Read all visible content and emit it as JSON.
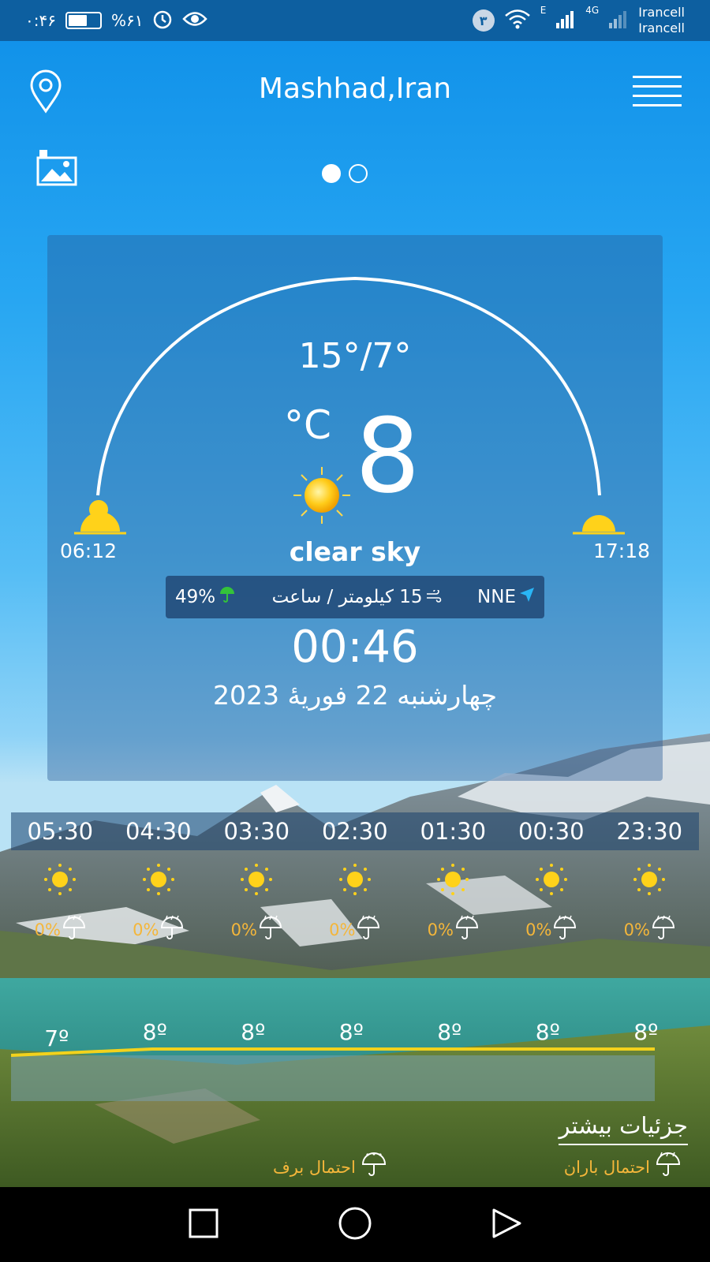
{
  "status_bar": {
    "time": "۰:۴۶",
    "battery_percent": "%۶۱",
    "battery_level": 0.61,
    "notification_count": "۳",
    "carrier_1": "Irancell",
    "carrier_2": "Irancell",
    "network_label": "4G",
    "edge_label": "E"
  },
  "header": {
    "city": "Mashhad,Iran",
    "page_count": 2,
    "active_page": 1
  },
  "current": {
    "min_max": "15°/7°",
    "unit": "°C",
    "temperature": "8",
    "condition": "clear sky",
    "sunrise": "06:12",
    "sunset": "17:18",
    "humidity": "49%",
    "wind_speed": "15 کیلومتر / ساعت",
    "wind_direction": "NNE",
    "clock": "00:46",
    "date": "چهارشنبه 22 فوریهٔ 2023"
  },
  "hourly": {
    "hours": [
      "05:30",
      "04:30",
      "03:30",
      "02:30",
      "01:30",
      "00:30",
      "23:30"
    ],
    "rain_chance": [
      "0%",
      "0%",
      "0%",
      "0%",
      "0%",
      "0%",
      "0%"
    ],
    "temps": [
      "7º",
      "8º",
      "8º",
      "8º",
      "8º",
      "8º",
      "8º"
    ],
    "temp_values": [
      7,
      8,
      8,
      8,
      8,
      8,
      8
    ],
    "icon": "sun-icon"
  },
  "footer": {
    "more_details": "جزئیات بیشتر",
    "rain_probability": "احتمال باران",
    "snow_probability": "احتمال برف"
  },
  "colors": {
    "accent": "#f4b63a",
    "status_bar": "#0d5fa0",
    "sky": "#1f9cf0",
    "graph_line": "#f3d21c"
  }
}
